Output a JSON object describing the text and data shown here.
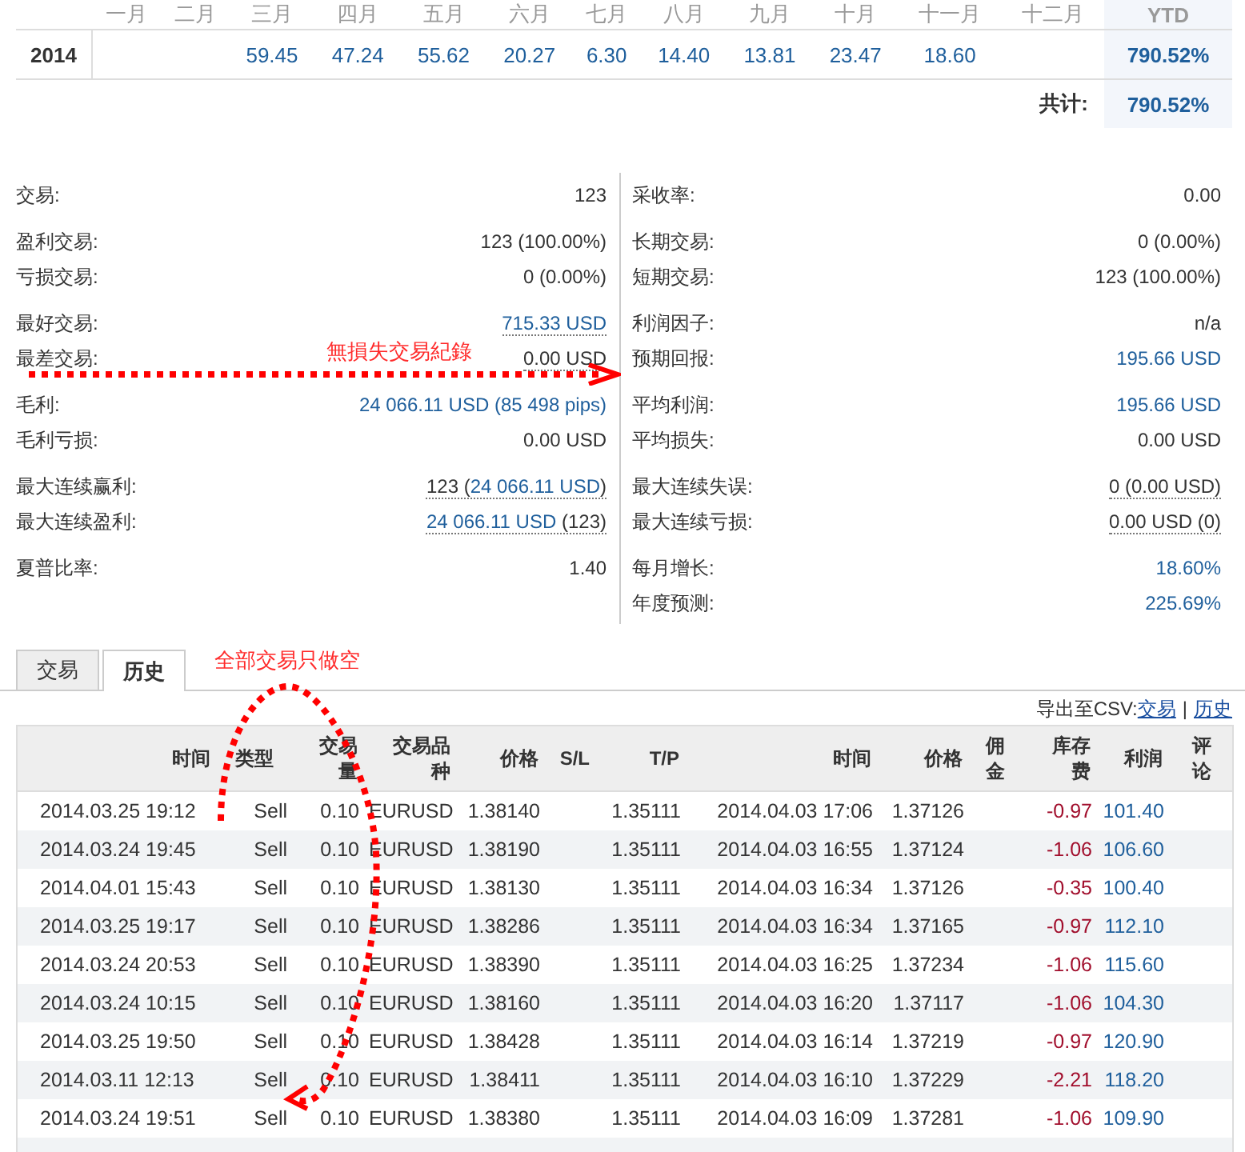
{
  "monthly": {
    "months": [
      "一月",
      "二月",
      "三月",
      "四月",
      "五月",
      "六月",
      "七月",
      "八月",
      "九月",
      "十月",
      "十一月",
      "十二月"
    ],
    "ytd_header": "YTD",
    "rows": [
      {
        "year": "2014",
        "cells": [
          {},
          {},
          {
            "value": "59.45"
          },
          {
            "value": "47.24"
          },
          {
            "value": "55.62"
          },
          {
            "value": "20.27"
          },
          {
            "value": "6.30"
          },
          {
            "value": "14.40"
          },
          {
            "value": "13.81"
          },
          {
            "value": "23.47"
          },
          {
            "value": "18.60"
          },
          {}
        ],
        "ytd": "790.52%"
      }
    ],
    "total_label": "共计:",
    "total": "790.52%"
  },
  "stats": {
    "left": [
      [
        {
          "label": "交易:",
          "underlined": false,
          "parts": [
            {
              "text": "123",
              "kind": "plain"
            }
          ]
        }
      ],
      [
        {
          "label": "盈利交易:",
          "underlined": false,
          "parts": [
            {
              "text": "123 (100.00%)",
              "kind": "plain"
            }
          ]
        },
        {
          "label": "亏损交易:",
          "underlined": false,
          "parts": [
            {
              "text": "0 (0.00%)",
              "kind": "plain"
            }
          ]
        }
      ],
      [
        {
          "label": "最好交易:",
          "underlined": true,
          "parts": [
            {
              "text": "715.33 USD",
              "kind": "blue"
            }
          ]
        },
        {
          "label": "最差交易:",
          "underlined": true,
          "parts": [
            {
              "text": "0.00 USD",
              "kind": "plain"
            }
          ]
        }
      ],
      [
        {
          "label": "毛利:",
          "underlined": false,
          "parts": [
            {
              "text": "24 066.11 USD (85 498 pips)",
              "kind": "blue"
            }
          ]
        },
        {
          "label": "毛利亏损:",
          "underlined": false,
          "parts": [
            {
              "text": "0.00 USD",
              "kind": "plain"
            }
          ]
        }
      ],
      [
        {
          "label": "最大连续赢利:",
          "underlined": true,
          "parts": [
            {
              "text": "123 (",
              "kind": "plain"
            },
            {
              "text": "24 066.11 USD",
              "kind": "blue"
            },
            {
              "text": ")",
              "kind": "plain"
            }
          ]
        },
        {
          "label": "最大连续盈利:",
          "underlined": true,
          "parts": [
            {
              "text": "24 066.11 USD",
              "kind": "blue"
            },
            {
              "text": " (123)",
              "kind": "plain"
            }
          ]
        }
      ],
      [
        {
          "label": "夏普比率:",
          "underlined": false,
          "parts": [
            {
              "text": "1.40",
              "kind": "plain"
            }
          ]
        }
      ]
    ],
    "right": [
      [
        {
          "label": "采收率:",
          "underlined": false,
          "parts": [
            {
              "text": "0.00",
              "kind": "plain"
            }
          ]
        }
      ],
      [
        {
          "label": "长期交易:",
          "underlined": false,
          "parts": [
            {
              "text": "0 (0.00%)",
              "kind": "plain"
            }
          ]
        },
        {
          "label": "短期交易:",
          "underlined": false,
          "parts": [
            {
              "text": "123 (100.00%)",
              "kind": "plain"
            }
          ]
        }
      ],
      [
        {
          "label": "利润因子:",
          "underlined": false,
          "parts": [
            {
              "text": "n/a",
              "kind": "plain"
            }
          ]
        },
        {
          "label": "预期回报:",
          "underlined": false,
          "parts": [
            {
              "text": "195.66 USD",
              "kind": "blue"
            }
          ]
        }
      ],
      [
        {
          "label": "平均利润:",
          "underlined": false,
          "parts": [
            {
              "text": "195.66 USD",
              "kind": "blue"
            }
          ]
        },
        {
          "label": "平均损失:",
          "underlined": false,
          "parts": [
            {
              "text": "0.00 USD",
              "kind": "plain"
            }
          ]
        }
      ],
      [
        {
          "label": "最大连续失误:",
          "underlined": true,
          "parts": [
            {
              "text": "0 (0.00 USD)",
              "kind": "plain"
            }
          ]
        },
        {
          "label": "最大连续亏损:",
          "underlined": true,
          "parts": [
            {
              "text": "0.00 USD (0)",
              "kind": "plain"
            }
          ]
        }
      ],
      [
        {
          "label": "每月增长:",
          "underlined": false,
          "parts": [
            {
              "text": "18.60%",
              "kind": "blue"
            }
          ]
        },
        {
          "label": "年度预测:",
          "underlined": false,
          "parts": [
            {
              "text": "225.69%",
              "kind": "blue"
            }
          ]
        }
      ]
    ]
  },
  "tabs": [
    {
      "label": "交易",
      "selected": false
    },
    {
      "label": "历史",
      "selected": true
    }
  ],
  "export": {
    "label": "导出至CSV:",
    "links": [
      "交易",
      "历史"
    ],
    "separator": "|"
  },
  "trades": {
    "columns": [
      "时间",
      "类型",
      "交易量",
      "交易品种",
      "价格",
      "S/L",
      "T/P",
      "时间",
      "价格",
      "佣金",
      "库存费",
      "利润",
      "评论"
    ],
    "rows": [
      {
        "open_time": "2014.03.25 19:12",
        "type": "Sell",
        "volume": "0.10",
        "symbol": "EURUSD",
        "open_price": "1.38140",
        "take_profit": "1.35111",
        "close_time": "2014.04.03 17:06",
        "close_price": "1.37126",
        "swap": "-0.97",
        "profit": "101.40"
      },
      {
        "open_time": "2014.03.24 19:45",
        "type": "Sell",
        "volume": "0.10",
        "symbol": "EURUSD",
        "open_price": "1.38190",
        "take_profit": "1.35111",
        "close_time": "2014.04.03 16:55",
        "close_price": "1.37124",
        "swap": "-1.06",
        "profit": "106.60"
      },
      {
        "open_time": "2014.04.01 15:43",
        "type": "Sell",
        "volume": "0.10",
        "symbol": "EURUSD",
        "open_price": "1.38130",
        "take_profit": "1.35111",
        "close_time": "2014.04.03 16:34",
        "close_price": "1.37126",
        "swap": "-0.35",
        "profit": "100.40"
      },
      {
        "open_time": "2014.03.25 19:17",
        "type": "Sell",
        "volume": "0.10",
        "symbol": "EURUSD",
        "open_price": "1.38286",
        "take_profit": "1.35111",
        "close_time": "2014.04.03 16:34",
        "close_price": "1.37165",
        "swap": "-0.97",
        "profit": "112.10"
      },
      {
        "open_time": "2014.03.24 20:53",
        "type": "Sell",
        "volume": "0.10",
        "symbol": "EURUSD",
        "open_price": "1.38390",
        "take_profit": "1.35111",
        "close_time": "2014.04.03 16:25",
        "close_price": "1.37234",
        "swap": "-1.06",
        "profit": "115.60"
      },
      {
        "open_time": "2014.03.24 10:15",
        "type": "Sell",
        "volume": "0.10",
        "symbol": "EURUSD",
        "open_price": "1.38160",
        "take_profit": "1.35111",
        "close_time": "2014.04.03 16:20",
        "close_price": "1.37117",
        "swap": "-1.06",
        "profit": "104.30"
      },
      {
        "open_time": "2014.03.25 19:50",
        "type": "Sell",
        "volume": "0.10",
        "symbol": "EURUSD",
        "open_price": "1.38428",
        "take_profit": "1.35111",
        "close_time": "2014.04.03 16:14",
        "close_price": "1.37219",
        "swap": "-0.97",
        "profit": "120.90"
      },
      {
        "open_time": "2014.03.11 12:13",
        "type": "Sell",
        "volume": "0.10",
        "symbol": "EURUSD",
        "open_price": "1.38411",
        "take_profit": "1.35111",
        "close_time": "2014.04.03 16:10",
        "close_price": "1.37229",
        "swap": "-2.21",
        "profit": "118.20"
      },
      {
        "open_time": "2014.03.24 19:51",
        "type": "Sell",
        "volume": "0.10",
        "symbol": "EURUSD",
        "open_price": "1.38380",
        "take_profit": "1.35111",
        "close_time": "2014.04.03 16:09",
        "close_price": "1.37281",
        "swap": "-1.06",
        "profit": "109.90"
      }
    ]
  },
  "annotations": [
    {
      "kind": "arrow",
      "text": "無損失交易紀錄"
    },
    {
      "kind": "loop",
      "text": "全部交易只做空"
    }
  ]
}
